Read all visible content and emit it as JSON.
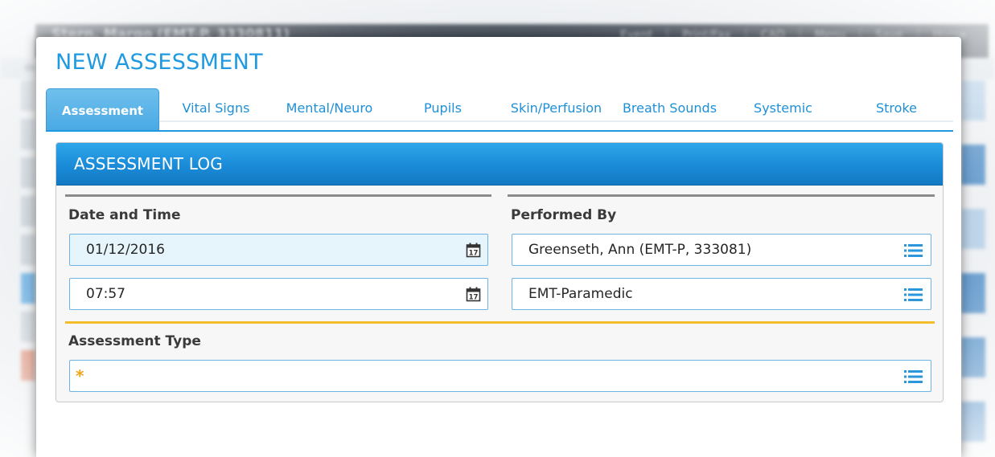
{
  "background": {
    "app_title": "Stern, Margo (EMT-P, 3330811)",
    "menu": [
      "Event",
      "Print/Fax",
      "CAD",
      "Menu",
      "Save",
      "Home"
    ],
    "sub_text": "de"
  },
  "modal": {
    "title": "NEW ASSESSMENT",
    "tabs": [
      {
        "label": "Assessment",
        "active": true
      },
      {
        "label": "Vital Signs",
        "active": false
      },
      {
        "label": "Mental/Neuro",
        "active": false
      },
      {
        "label": "Pupils",
        "active": false
      },
      {
        "label": "Skin/Perfusion",
        "active": false
      },
      {
        "label": "Breath Sounds",
        "active": false
      },
      {
        "label": "Systemic",
        "active": false
      },
      {
        "label": "Stroke",
        "active": false
      }
    ],
    "panel": {
      "title": "ASSESSMENT LOG",
      "date_time": {
        "label": "Date and Time",
        "date_value": "01/12/2016",
        "time_value": "07:57",
        "calendar_icon_day": "17"
      },
      "performed_by": {
        "label": "Performed By",
        "name_value": "Greenseth, Ann (EMT-P, 333081)",
        "role_value": "EMT-Paramedic"
      },
      "assessment_type": {
        "label": "Assessment Type",
        "required_marker": "*",
        "value": ""
      }
    }
  },
  "colors": {
    "accent": "#1f9ae0",
    "header_blue": "#1a8bd8",
    "field_border": "#6db3e6",
    "required": "#f2a516",
    "divider_yellow": "#f3bd2b"
  }
}
